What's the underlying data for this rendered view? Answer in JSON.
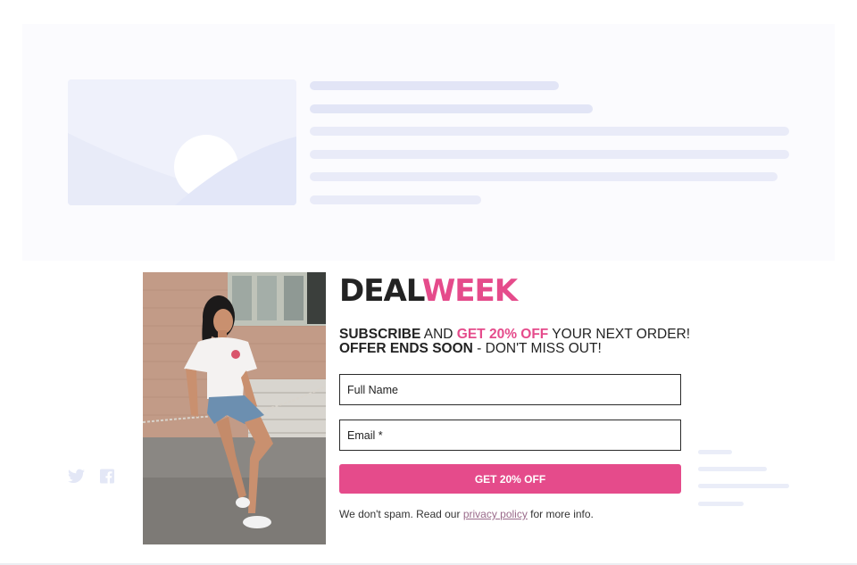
{
  "popup": {
    "title_part1": "DEAL",
    "title_part2": "WEEK",
    "line1": {
      "bold1": "SUBSCRIBE",
      "text1": " AND ",
      "accent": "GET 20% OFF",
      "text2": " YOUR NEXT ORDER!"
    },
    "line2": {
      "bold": "OFFER ENDS SOON",
      "text": " - DON'T MISS OUT!"
    },
    "name_placeholder": "Full Name",
    "email_placeholder": "Email *",
    "cta_label": "GET 20% OFF",
    "note_before": "We don't spam. Read our ",
    "note_link": "privacy policy",
    "note_after": " for more info."
  },
  "social": {
    "icons": [
      "twitter-icon",
      "facebook-icon"
    ]
  },
  "colors": {
    "accent": "#e54b8b",
    "text": "#232323",
    "placeholder": "#e9ebf8"
  }
}
